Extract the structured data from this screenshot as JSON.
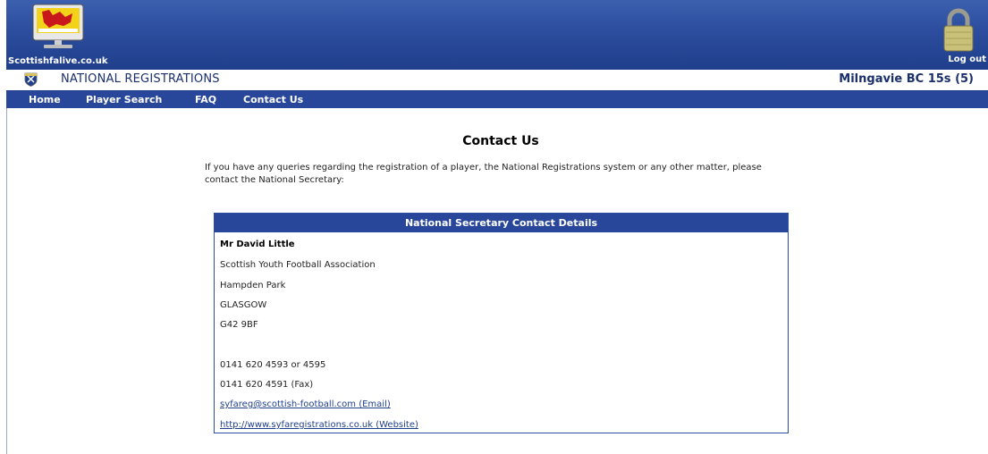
{
  "banner": {
    "site_name": "Scottishfalive.co.uk",
    "logout_label": "Log out",
    "logo_icon": "monitor-logo-icon",
    "lock_icon": "padlock-icon"
  },
  "registrations": {
    "title": "NATIONAL REGISTRATIONS",
    "team": "Milngavie BC 15s (5)",
    "crest_icon": "club-crest-icon"
  },
  "nav": {
    "items": [
      {
        "label": "Home"
      },
      {
        "label": "Player Search"
      },
      {
        "label": "FAQ"
      },
      {
        "label": "Contact Us"
      }
    ]
  },
  "page": {
    "title": "Contact Us",
    "intro": "If you have any queries regarding the registration of a player, the National Registrations system or any other matter, please contact the National Secretary:"
  },
  "contact": {
    "header": "National Secretary Contact Details",
    "name": "Mr David Little",
    "org": "Scottish Youth Football Association",
    "addr1": "Hampden Park",
    "city": "GLASGOW",
    "postcode": "G42 9BF",
    "phone": "0141 620 4593 or 4595",
    "fax": "0141 620 4591 (Fax)",
    "email": "syfareg@scottish-football.com (Email)",
    "website": "http://www.syfaregistrations.co.uk (Website)"
  },
  "colors": {
    "brand_blue": "#28479a",
    "banner_dark": "#1f3f8c",
    "link": "#1f3f8c"
  }
}
